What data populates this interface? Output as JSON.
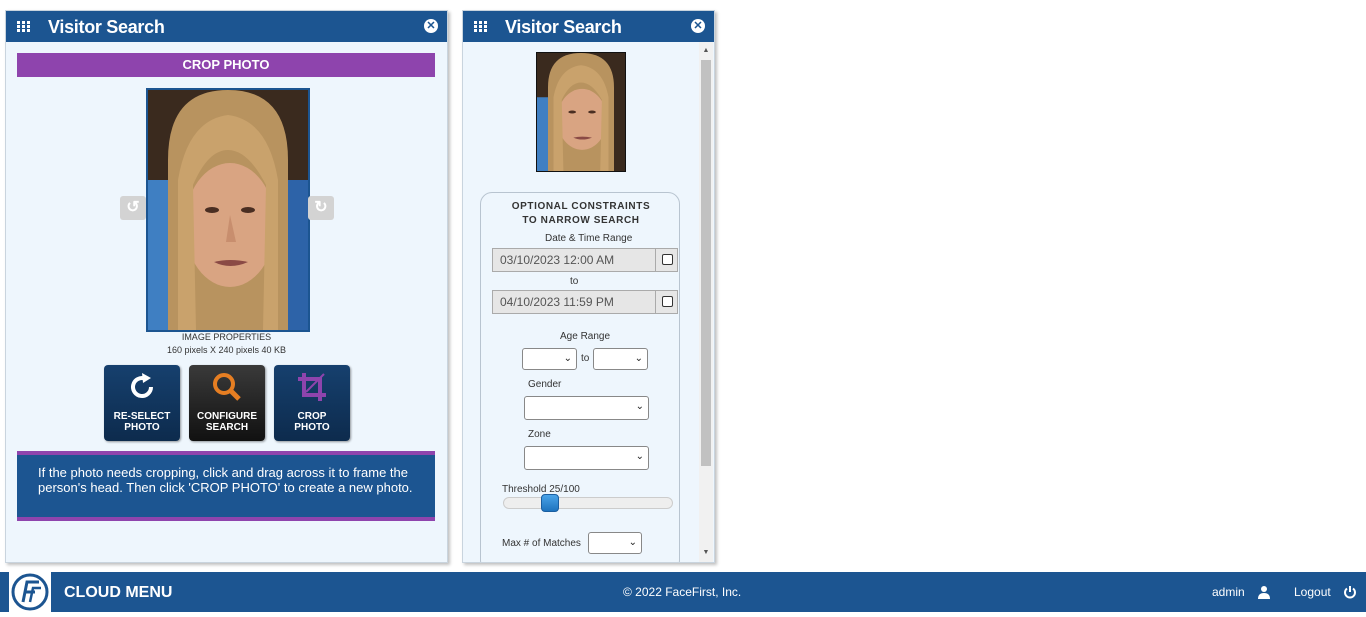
{
  "left_panel": {
    "title": "Visitor Search",
    "crop_header": "CROP PHOTO",
    "image_props_title": "IMAGE PROPERTIES",
    "image_props_value": "160 pixels X 240 pixels 40 KB",
    "buttons": {
      "reselect_line1": "RE-SELECT",
      "reselect_line2": "PHOTO",
      "configure_line1": "CONFIGURE",
      "configure_line2": "SEARCH",
      "crop_line1": "CROP",
      "crop_line2": "PHOTO"
    },
    "info_text": "If the photo needs cropping, click and drag across it to frame the person's head. Then click 'CROP PHOTO' to create a new photo."
  },
  "right_panel": {
    "title": "Visitor Search",
    "constraints_title_1": "OPTIONAL CONSTRAINTS",
    "constraints_title_2": "TO NARROW SEARCH",
    "date_range_label": "Date & Time Range",
    "date_from": "03/10/2023 12:00 AM",
    "to_label": "to",
    "date_to": "04/10/2023 11:59 PM",
    "age_range_label": "Age Range",
    "age_to_label": "to",
    "gender_label": "Gender",
    "zone_label": "Zone",
    "threshold_label": "Threshold 25/100",
    "threshold_value": 25,
    "max_matches_label": "Max # of Matches"
  },
  "footer": {
    "menu_title": "CLOUD MENU",
    "copyright": "© 2022 FaceFirst, Inc.",
    "user": "admin",
    "logout": "Logout"
  },
  "colors": {
    "brand_blue": "#1c5591",
    "accent_purple": "#8e44ad"
  }
}
